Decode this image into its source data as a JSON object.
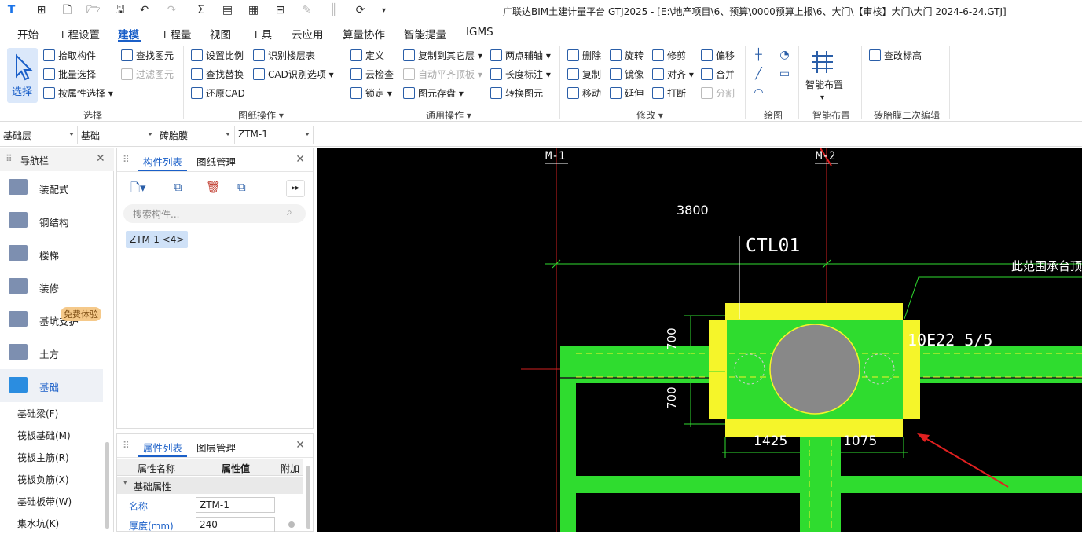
{
  "window_title": "广联达BIM土建计量平台 GTJ2025 - [E:\\地产项目\\6、预算\\0000预算上报\\6、大门\\【审核】大门\\大门 2024-6-24.GTJ]",
  "tabs": [
    "开始",
    "工程设置",
    "建模",
    "工程量",
    "视图",
    "工具",
    "云应用",
    "算量协作",
    "智能提量",
    "IGMS"
  ],
  "ribbon": {
    "select_label": "选择",
    "pick": "拾取构件",
    "batch": "批量选择",
    "byprop": "按属性选择",
    "find_elem": "查找图元",
    "filter_elem": "过滤图元",
    "set_scale": "设置比例",
    "find_replace": "查找替换",
    "restore_cad": "还原CAD",
    "recog_layers": "识别楼层表",
    "cad_recog": "CAD识别选项",
    "define": "定义",
    "cloud_check": "云检查",
    "lock": "锁定",
    "copy_other": "复制到其它层",
    "auto_align": "自动平齐顶板",
    "save_elem": "图元存盘",
    "two_axis": "两点辅轴",
    "length_dim": "长度标注",
    "convert_elem": "转换图元",
    "delete": "删除",
    "rotate": "旋转",
    "trim": "修剪",
    "offset": "偏移",
    "copy": "复制",
    "mirror": "镜像",
    "align": "对齐",
    "merge": "合并",
    "move": "移动",
    "extend": "延伸",
    "break": "打断",
    "split": "分割",
    "smart_layout": "智能布置",
    "edit_top": "查改标高",
    "groups": {
      "select": "选择",
      "drawing_ops": "图纸操作",
      "common_ops": "通用操作",
      "modify": "修改",
      "draw": "绘图",
      "smart": "智能布置",
      "brick_edit": "砖胎膜二次编辑"
    }
  },
  "dropdowns": [
    "基础层",
    "基础",
    "砖胎膜",
    "ZTM-1"
  ],
  "nav": {
    "title": "导航栏",
    "items": [
      "装配式",
      "钢结构",
      "楼梯",
      "装修",
      "基坑支护",
      "土方",
      "基础"
    ],
    "badge": "免费体验",
    "subitems": [
      "基础梁(F)",
      "筏板基础(M)",
      "筏板主筋(R)",
      "筏板负筋(X)",
      "基础板带(W)",
      "集水坑(K)"
    ]
  },
  "comp_panel": {
    "tab1": "构件列表",
    "tab2": "图纸管理",
    "search_placeholder": "搜索构件...",
    "item": "ZTM-1 <4>"
  },
  "props_panel": {
    "tab1": "属性列表",
    "tab2": "图层管理",
    "col_name": "属性名称",
    "col_value": "属性值",
    "col_extra": "附加",
    "section": "基础属性",
    "rows": [
      {
        "name": "名称",
        "value": "ZTM-1"
      },
      {
        "name": "厚度(mm)",
        "value": "240"
      }
    ]
  },
  "cad": {
    "axis1": "M-1",
    "axis2": "M-2",
    "dim_top": "3800",
    "label": "CTL01",
    "note": "此范围承台顶标高",
    "rebar": "10E22 5/5",
    "dim_v1": "700",
    "dim_v2": "700",
    "dim_h1": "1425",
    "dim_h2": "1075"
  },
  "colors": {
    "accent": "#1a5fc8",
    "cad_green": "#2fdc2f",
    "cad_yellow": "#f5f52a",
    "cad_red": "#e02020"
  }
}
